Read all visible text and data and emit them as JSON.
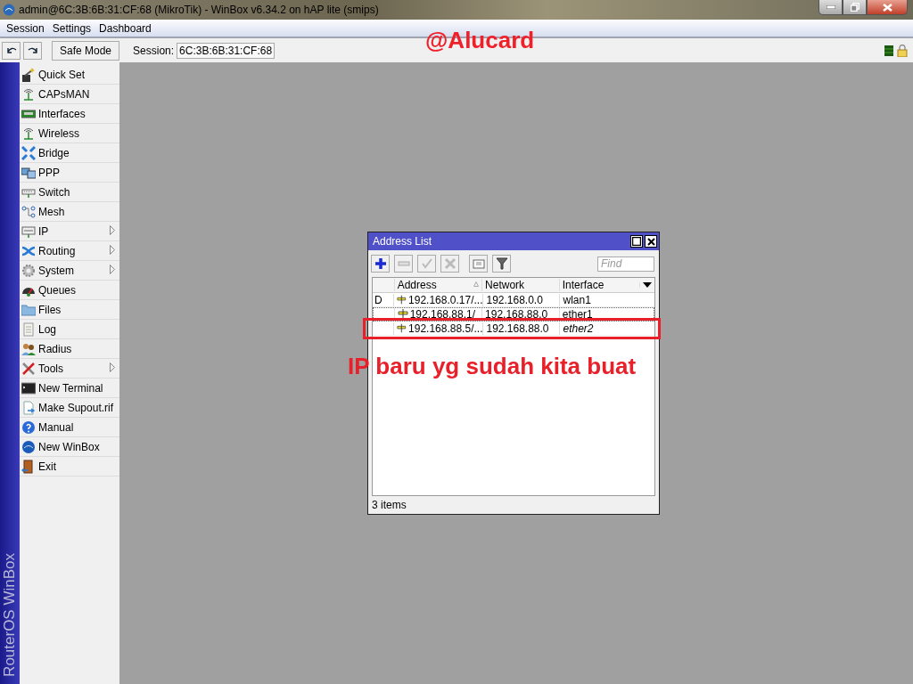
{
  "window": {
    "title": "admin@6C:3B:6B:31:CF:68 (MikroTik) - WinBox v6.34.2 on hAP lite (smips)"
  },
  "menu_bar": [
    "Session",
    "Settings",
    "Dashboard"
  ],
  "toolbar": {
    "safe_mode": {
      "label": "Safe Mode",
      "on": false
    },
    "session_label": "Session:",
    "session_value": "6C:3B:6B:31:CF:68"
  },
  "sidebar": {
    "brand": "RouterOS WinBox",
    "items": [
      {
        "label": "Quick Set",
        "submenu": false
      },
      {
        "label": "CAPsMAN",
        "submenu": false
      },
      {
        "label": "Interfaces",
        "submenu": false
      },
      {
        "label": "Wireless",
        "submenu": false
      },
      {
        "label": "Bridge",
        "submenu": false
      },
      {
        "label": "PPP",
        "submenu": false
      },
      {
        "label": "Switch",
        "submenu": false
      },
      {
        "label": "Mesh",
        "submenu": false
      },
      {
        "label": "IP",
        "submenu": true
      },
      {
        "label": "Routing",
        "submenu": true
      },
      {
        "label": "System",
        "submenu": true
      },
      {
        "label": "Queues",
        "submenu": false
      },
      {
        "label": "Files",
        "submenu": false
      },
      {
        "label": "Log",
        "submenu": false
      },
      {
        "label": "Radius",
        "submenu": false
      },
      {
        "label": "Tools",
        "submenu": true
      },
      {
        "label": "New Terminal",
        "submenu": false
      },
      {
        "label": "Make Supout.rif",
        "submenu": false
      },
      {
        "label": "Manual",
        "submenu": false
      },
      {
        "label": "New WinBox",
        "submenu": false
      },
      {
        "label": "Exit",
        "submenu": false
      }
    ]
  },
  "address_list": {
    "title": "Address List",
    "find_placeholder": "Find",
    "columns": [
      {
        "label": "Address",
        "sorted": true
      },
      {
        "label": "Network"
      },
      {
        "label": "Interface"
      }
    ],
    "rows": [
      {
        "flag": "D",
        "address": "192.168.0.17/...",
        "network": "192.168.0.0",
        "interface": "wlan1",
        "focused": false,
        "interface_italic": false
      },
      {
        "address": "192.168.88.1/",
        "network": "192.168.88.0",
        "interface": "ether1",
        "focused": true,
        "interface_italic": false
      },
      {
        "address": "192.168.88.5/...",
        "network": "192.168.88.0",
        "interface": "ether2",
        "focused": false,
        "interface_italic": true
      }
    ],
    "status": "3 items"
  },
  "annotations": [
    {
      "kind": "signature",
      "text": "@Alucard"
    },
    {
      "kind": "highlight",
      "text": "IP baru yg sudah kita buat"
    }
  ]
}
